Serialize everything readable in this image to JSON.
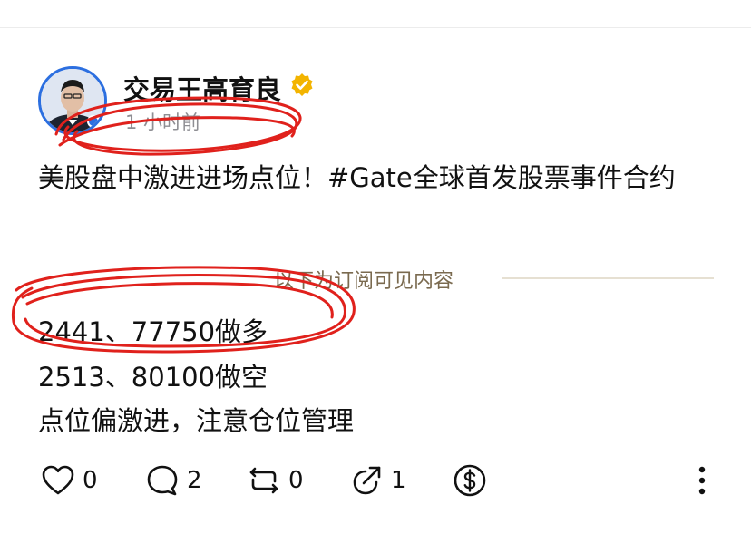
{
  "post": {
    "author": "交易王高育良",
    "time": "1 小时前",
    "text": "美股盘中激进进场点位！#Gate全球首发股票事件合约",
    "divider_label": "以下为订阅可见内容",
    "lines": [
      "2441、77750做多",
      "2513、80100做空",
      "点位偏激进，注意仓位管理"
    ]
  },
  "actions": {
    "like_count": "0",
    "comment_count": "2",
    "repost_count": "0",
    "share_count": "1"
  },
  "colors": {
    "verified_badge": "#f3b400",
    "annotation_red": "#e0211c",
    "avatar_ring": "#2c6fe0"
  },
  "icons": [
    "heart-icon",
    "comment-icon",
    "repost-icon",
    "share-icon",
    "dollar-icon",
    "more-icon",
    "verified-icon"
  ]
}
